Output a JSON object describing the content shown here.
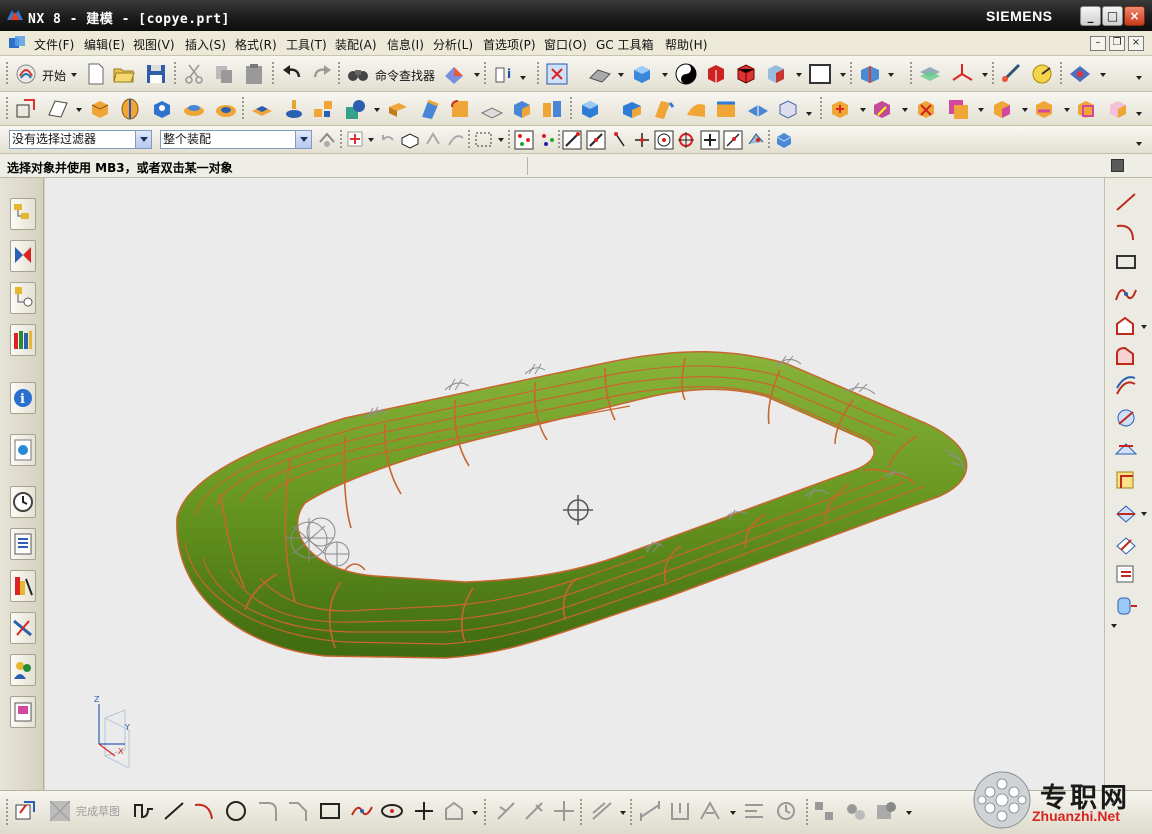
{
  "titlebar": {
    "title": "NX 8 - 建模 - [copye.prt]",
    "brand": "SIEMENS"
  },
  "menubar": {
    "items": [
      "文件(F)",
      "编辑(E)",
      "视图(V)",
      "插入(S)",
      "格式(R)",
      "工具(T)",
      "装配(A)",
      "信息(I)",
      "分析(L)",
      "首选项(P)",
      "窗口(O)",
      "GC 工具箱",
      "帮助(H)"
    ]
  },
  "toolbar": {
    "start_label": "开始",
    "command_finder_label": "命令查找器"
  },
  "selection_bar": {
    "filter_value": "没有选择过滤器",
    "scope_value": "整个装配"
  },
  "cue": {
    "text": "选择对象并使用 MB3，或者双击某一对象"
  },
  "sketch_toolbar": {
    "finish_sketch_label": "完成草图"
  },
  "viewport": {
    "model": "toroidal-coil-ring",
    "colors": {
      "body": "#5f8f1e",
      "highlight": "#9cc43c",
      "edge": "#c8662f",
      "background": "#ebebeb"
    },
    "triad_labels": {
      "x": "X",
      "y": "Y",
      "z": "Z"
    }
  },
  "watermark": {
    "text": "专职网",
    "url": "Zhuanzhi.Net"
  }
}
